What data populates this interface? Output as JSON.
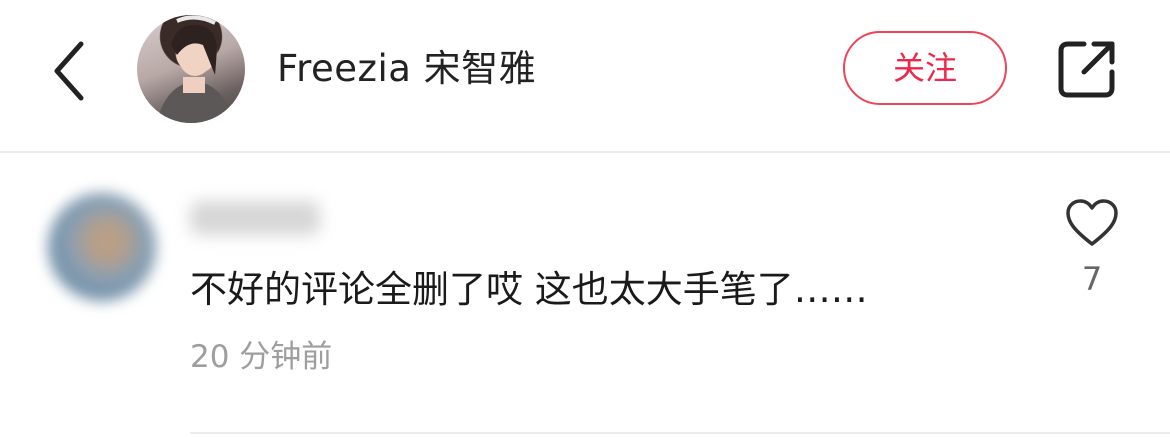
{
  "header": {
    "user_name": "Freezia 宋智雅",
    "follow_label": "关注",
    "icons": {
      "back": "chevron-left-icon",
      "share": "share-external-icon"
    }
  },
  "comment": {
    "text": "不好的评论全删了哎 这也太大手笔了……",
    "time": "20 分钟前",
    "like_count": "7",
    "icons": {
      "like": "heart-outline-icon"
    }
  },
  "colors": {
    "accent": "#f0264a",
    "text_primary": "#1a1a1a",
    "text_secondary": "#9e9e9e",
    "divider": "#ececec"
  }
}
